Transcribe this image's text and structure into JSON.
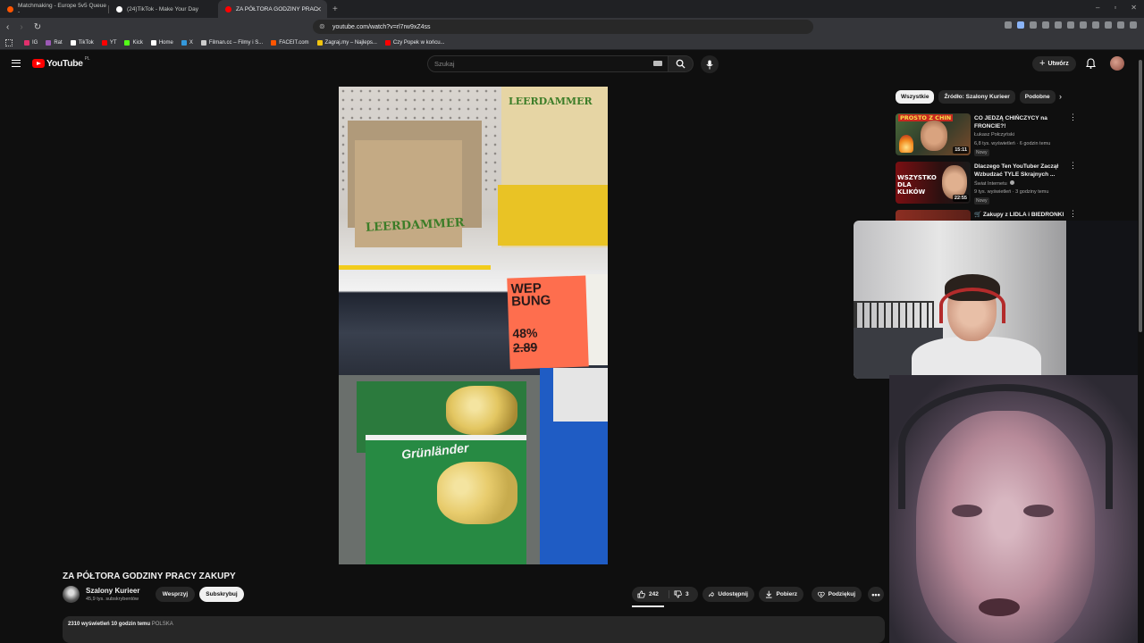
{
  "browser": {
    "tabs": [
      {
        "title": "Matchmaking - Europe 5v5 Queue -",
        "color": "#ff5500",
        "active": false
      },
      {
        "title": "(24)TikTok - Make Your Day",
        "color": "#ffffff",
        "active": false
      },
      {
        "title": "ZA PÓŁTORA GODZINY PRAC",
        "color": "#ff0000",
        "active": true
      }
    ],
    "url": "youtube.com/watch?v=rl7rw9xZ4ss",
    "bookmarks": [
      {
        "label": "IG",
        "color": "#e1306c"
      },
      {
        "label": "Rat",
        "color": "#9b59b6"
      },
      {
        "label": "TikTok",
        "color": "#ffffff"
      },
      {
        "label": "YT",
        "color": "#ff0000"
      },
      {
        "label": "Kick",
        "color": "#53fc18"
      },
      {
        "label": "Home",
        "color": "#ffffff"
      },
      {
        "label": "X",
        "color": "#3498db"
      },
      {
        "label": "Filman.cc – Filmy i S...",
        "color": "#cccccc"
      },
      {
        "label": "FACEIT.com",
        "color": "#ff5500"
      },
      {
        "label": "Zagraj.my – Najleps...",
        "color": "#f1c40f"
      },
      {
        "label": "Czy Popek w końcu...",
        "color": "#ff0000"
      }
    ]
  },
  "youtube": {
    "logo_text": "YouTube",
    "region": "PL",
    "search_placeholder": "Szukaj",
    "create_label": "Utwórz",
    "video": {
      "title": "ZA PÓŁTORA GODZINY PRACY ZAKUPY",
      "price_tag_word": "WEP\nBUNG",
      "price_pct": "48%",
      "price_old": "2.89"
    },
    "channel": {
      "name": "Szalony Kurieer",
      "subs": "45,9 tys. subskrybentów",
      "support_label": "Wesprzyj",
      "subscribe_label": "Subskrybuj"
    },
    "actions": {
      "likes": "242",
      "dislikes": "3",
      "share": "Udostępnij",
      "download": "Pobierz",
      "thanks": "Podziękuj"
    },
    "description": {
      "stats": "2310 wyświetleń  10 godzin temu",
      "tag": "POLSKA"
    },
    "chips": [
      "Wszystkie",
      "Źródło: Szalony Kurieer",
      "Podobne"
    ],
    "recommendations": [
      {
        "title": "CO JEDZĄ CHIŃCZYCY na FRONCIE?!",
        "channel": "Łukasz Połczyński",
        "meta": "6,8 tys. wyświetleń · 6 godzin temu",
        "badge": "Nowy",
        "duration": "15:11",
        "thumb_text": "PROSTO Z CHIN"
      },
      {
        "title": "Dlaczego Ten YouTuber Zaczął Wzbudzać TYLE Skrajnych ...",
        "channel": "Świat Internetu",
        "meta": "9 tys. wyświetleń · 3 godziny temu",
        "badge": "Nowy",
        "duration": "22:55",
        "thumb_text": "WSZYSTKO DLA KLIKÓW"
      },
      {
        "title": "Zakupy z LIDLA i BIEDRONKI",
        "channel": "",
        "meta": "",
        "badge": "",
        "duration": "",
        "thumb_text": ""
      }
    ]
  }
}
